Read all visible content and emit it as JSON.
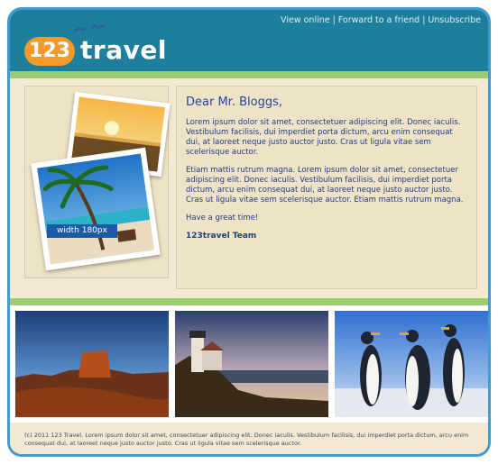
{
  "header": {
    "links": {
      "view_online": "View online",
      "forward": "Forward to a friend",
      "unsubscribe": "Unsubscribe",
      "separator": "|"
    },
    "logo": {
      "number": "123",
      "word": "travel"
    }
  },
  "hero": {
    "width_label": "width 180px"
  },
  "letter": {
    "greeting": "Dear Mr. Bloggs,",
    "paragraph_1": "Lorem ipsum dolor sit amet, consectetuer adipiscing elit. Donec iaculis. Vestibulum facilisis, dui imperdiet porta dictum, arcu enim consequat dui, at laoreet neque justo auctor justo. Cras ut ligula vitae sem scelerisque auctor.",
    "paragraph_2": "Etiam mattis rutrum magna. Lorem ipsum dolor sit amet, consectetuer adipiscing elit. Donec iaculis. Vestibulum facilisis, dui imperdiet porta dictum, arcu enim consequat dui, at laoreet neque justo auctor justo. Cras ut ligula vitae sem scelerisque auctor. Etiam mattis rutrum magna.",
    "closing": "Have a great time!",
    "signature": "123travel Team"
  },
  "gallery": {
    "images": [
      "desert-mesa-photo",
      "lighthouse-photo",
      "penguins-photo"
    ]
  },
  "footer": {
    "text": "(c) 2011 123 Travel. Lorem ipsum dolor sit amet, consectetuer adipiscing elit. Donec iaculis. Vestibulum facilisis, dui imperdiet porta dictum, arcu enim consequat dui, at laoreet neque justo auctor justo. Cras ut ligula vitae sem scelerisque auctor."
  },
  "colors": {
    "header": "#1e7f9c",
    "accent_green": "#9fcb75",
    "logo_orange": "#f39a2a",
    "frame_border": "#3f9bd2",
    "text_blue": "#1f3b85"
  }
}
